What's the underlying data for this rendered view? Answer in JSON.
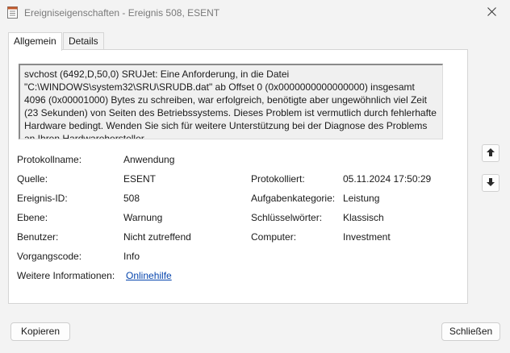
{
  "window": {
    "title": "Ereigniseigenschaften - Ereignis 508, ESENT",
    "app_icon": "event-properties-icon",
    "close_icon": "close-icon"
  },
  "tabs": [
    {
      "label": "Allgemein",
      "active": true
    },
    {
      "label": "Details",
      "active": false
    }
  ],
  "description": "svchost (6492,D,50,0) SRUJet: Eine Anforderung, in die Datei \"C:\\WINDOWS\\system32\\SRU\\SRUDB.dat\" ab Offset 0 (0x0000000000000000) insgesamt 4096 (0x00001000) Bytes zu schreiben, war erfolgreich, benötigte aber ungewöhnlich viel Zeit (23 Sekunden) von Seiten des Betriebssystems. Dieses Problem ist vermutlich durch fehlerhafte Hardware bedingt. Wenden Sie sich für weitere Unterstützung bei der Diagnose des Problems an Ihren Hardwarehersteller.",
  "fields": {
    "protokollname": {
      "label": "Protokollname:",
      "value": "Anwendung"
    },
    "quelle": {
      "label": "Quelle:",
      "value": "ESENT"
    },
    "protokolliert": {
      "label": "Protokolliert:",
      "value": "05.11.2024 17:50:29"
    },
    "ereignis_id": {
      "label": "Ereignis-ID:",
      "value": "508"
    },
    "aufgabenkategorie": {
      "label": "Aufgabenkategorie:",
      "value": "Leistung"
    },
    "ebene": {
      "label": "Ebene:",
      "value": "Warnung"
    },
    "schluesselwoerter": {
      "label": "Schlüsselwörter:",
      "value": "Klassisch"
    },
    "benutzer": {
      "label": "Benutzer:",
      "value": "Nicht zutreffend"
    },
    "computer": {
      "label": "Computer:",
      "value": "Investment"
    },
    "vorgangscode": {
      "label": "Vorgangscode:",
      "value": "Info"
    },
    "weitere_informationen": {
      "label": "Weitere Informationen:",
      "value": "Onlinehilfe"
    }
  },
  "nav": {
    "up_icon": "arrow-up-icon",
    "down_icon": "arrow-down-icon"
  },
  "buttons": {
    "copy": "Kopieren",
    "close": "Schließen"
  }
}
